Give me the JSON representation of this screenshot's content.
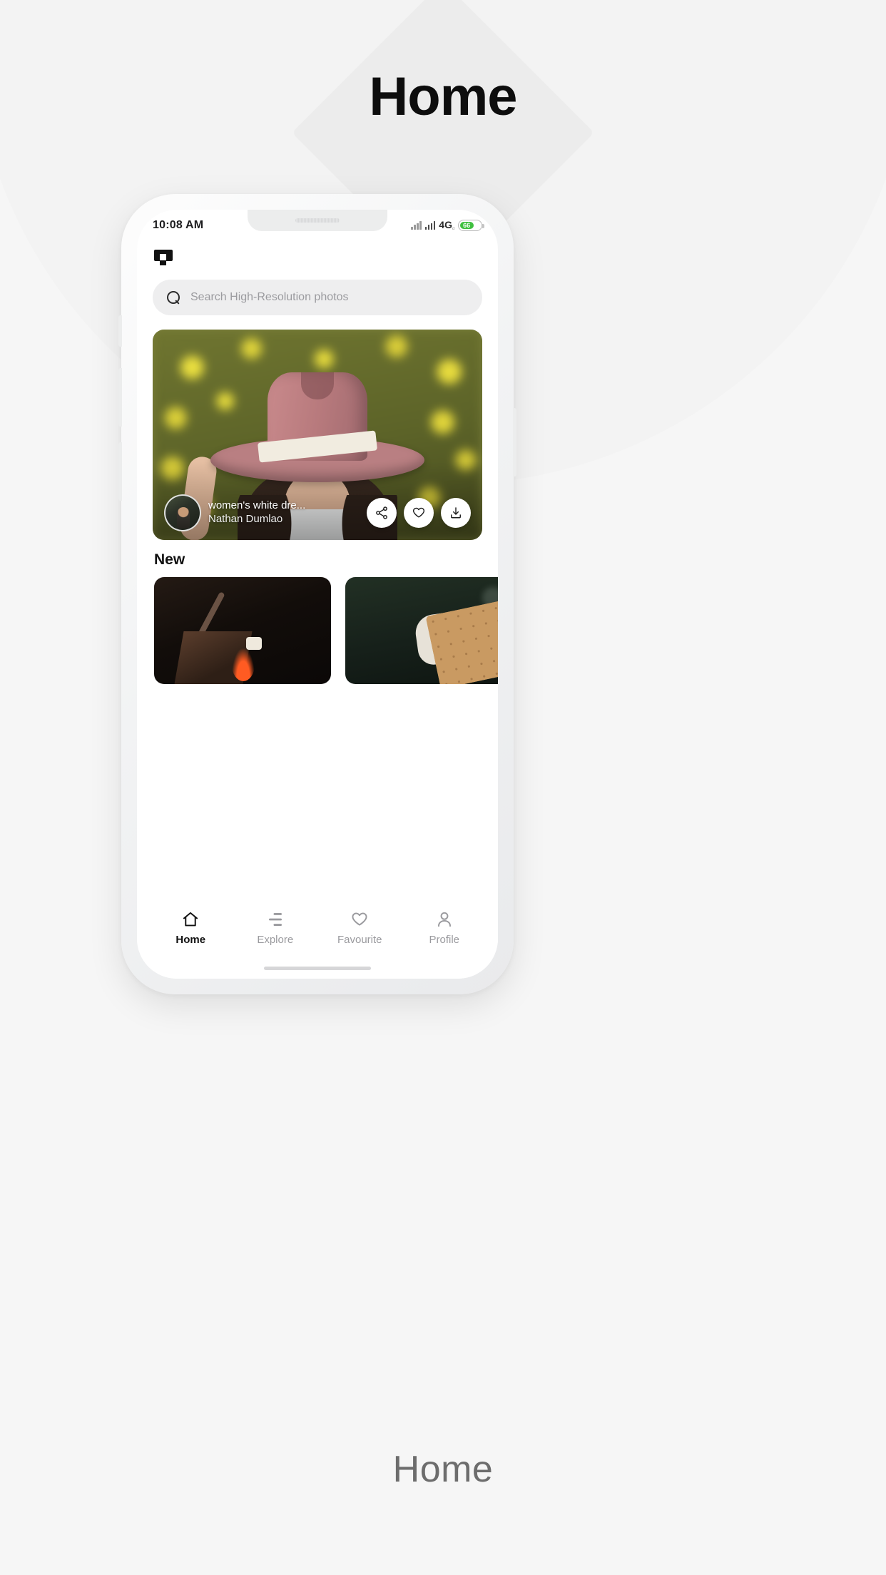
{
  "hero": {
    "title": "Home"
  },
  "caption": "Home",
  "phone": {
    "status": {
      "time": "10:08 AM",
      "network": "4G",
      "network_sub": "ᵈ",
      "battery_pct": "66",
      "battery_color": "#3fbf3f"
    },
    "header": {
      "logo_name": "camera-logo"
    },
    "search": {
      "placeholder": "Search High-Resolution photos",
      "icon": "search-icon"
    },
    "featured": {
      "title": "women's white dre...",
      "author": "Nathan Dumlao",
      "actions": [
        {
          "name": "share-icon",
          "label": "Share"
        },
        {
          "name": "heart-icon",
          "label": "Favourite"
        },
        {
          "name": "download-icon",
          "label": "Download"
        }
      ]
    },
    "section": {
      "title": "New",
      "thumbs": [
        {
          "name": "thumb-campfire-marshmallow"
        },
        {
          "name": "thumb-smore-graham-cracker"
        }
      ]
    },
    "tabs": [
      {
        "label": "Home",
        "icon": "home-icon",
        "active": true
      },
      {
        "label": "Explore",
        "icon": "explore-icon",
        "active": false
      },
      {
        "label": "Favourite",
        "icon": "heart-icon",
        "active": false
      },
      {
        "label": "Profile",
        "icon": "person-icon",
        "active": false
      }
    ]
  }
}
